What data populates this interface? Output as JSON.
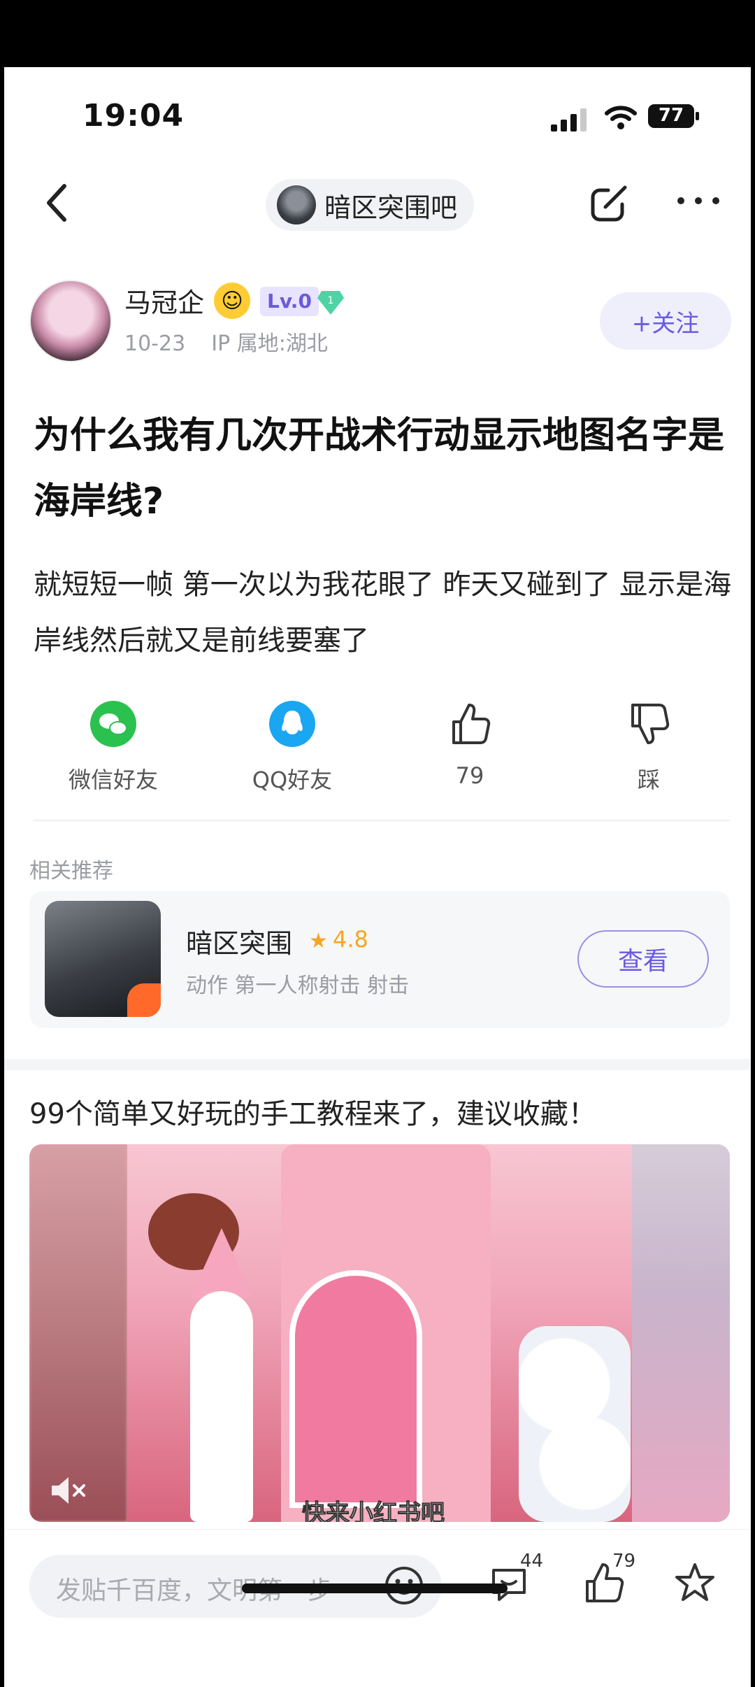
{
  "status_bar": {
    "time": "19:04",
    "battery": "77"
  },
  "nav": {
    "forum_name": "暗区突围吧"
  },
  "author": {
    "name": "马冠企",
    "level": "Lv.0",
    "badge_number": "1",
    "date": "10-23",
    "ip_location": "IP 属地:湖北",
    "follow_label": "+关注"
  },
  "post": {
    "title": "为什么我有几次开战术行动显示地图名字是海岸线?",
    "body": "就短短一帧 第一次以为我花眼了 昨天又碰到了 显示是海岸线然后就又是前线要塞了"
  },
  "actions": [
    {
      "label": "微信好友",
      "icon": "wechat-icon"
    },
    {
      "label": "QQ好友",
      "icon": "qq-icon"
    },
    {
      "label": "79",
      "icon": "thumbs-up-icon"
    },
    {
      "label": "踩",
      "icon": "thumbs-down-icon"
    }
  ],
  "related": {
    "heading": "相关推荐",
    "game_name": "暗区突围",
    "rating": "4.8",
    "tags": "动作 第一人称射击 射击",
    "view_label": "查看"
  },
  "ad": {
    "title": "99个简单又好玩的手工教程来了，建议收藏！",
    "caption": "快来小红书吧"
  },
  "bottom_bar": {
    "input_placeholder": "发贴千百度，文明第一步",
    "comments_count": "44",
    "likes_count": "79"
  },
  "colors": {
    "accent": "#6a5be0",
    "wechat": "#2bc14f",
    "qq": "#1aa6f0",
    "star": "#f5a623"
  }
}
